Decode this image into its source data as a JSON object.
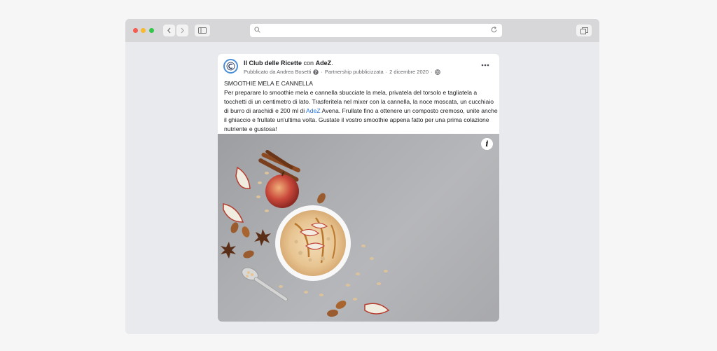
{
  "browser": {
    "url": ""
  },
  "post": {
    "page_name": "Il Club delle Ricette",
    "with_word": "con",
    "partner_name": "AdeZ",
    "published_by": "Pubblicato da Andrea Bosetti",
    "partnership": "Partnership pubblicizzata",
    "date": "2 dicembre 2020",
    "separator": "·",
    "more_icon": "more-dots-icon",
    "title": "SMOOTHIE MELA E CANNELLA",
    "body_before_link": "Per preparare lo smoothie mela e cannella sbucciate la mela, privatela del torsolo e tagliatela a tocchetti di un centimetro di lato. Trasferitela nel mixer con la cannella, la noce moscata, un cucchiaio di burro di arachidi e 200 ml di ",
    "body_link": "AdeZ",
    "body_after_link": " Avena. Frullate fino a ottenere un composto cremoso, unite anche il ghiaccio e frullate un'ultima volta. Gustate il vostro smoothie appena fatto per una prima colazione nutriente e gustosa!",
    "info_label": "i",
    "link_color": "#216fdb"
  }
}
